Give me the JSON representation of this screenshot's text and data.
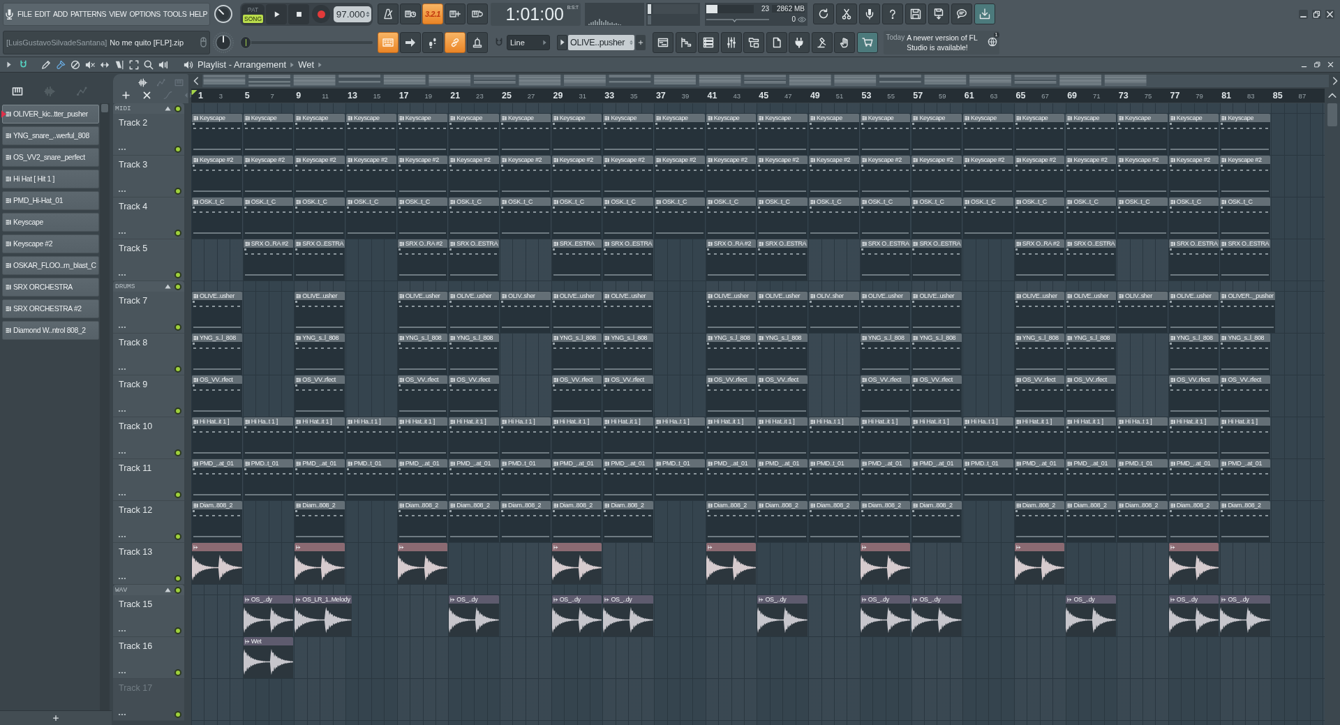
{
  "menu": [
    "FILE",
    "EDIT",
    "ADD",
    "PATTERNS",
    "VIEW",
    "OPTIONS",
    "TOOLS",
    "HELP"
  ],
  "hint": {
    "author": "[LuisGustavoSilvadeSantana]",
    "file": "No me quito [FLP].zip"
  },
  "transport": {
    "modes": [
      {
        "label": "PAT",
        "selected": false
      },
      {
        "label": "SONG",
        "selected": true
      }
    ],
    "tempo": "97.000",
    "pitch": {
      "level": 0
    }
  },
  "record_toggles": [
    {
      "on": false
    },
    {
      "on": false
    },
    {
      "label": "3.2.1",
      "on": true
    },
    {
      "on": false
    },
    {
      "on": false
    }
  ],
  "edit_toggles": [
    {
      "on": true
    },
    {
      "on": false
    },
    {
      "on": false
    },
    {
      "on": true
    },
    {
      "on": false
    }
  ],
  "time": {
    "value": "1:01:00",
    "format": "B:S:T"
  },
  "monitor": {
    "cpu": {
      "level": 0.23,
      "value": "23"
    },
    "memory": "2862 MB",
    "polyphony": "0"
  },
  "snap": {
    "value": "Line"
  },
  "pattern": {
    "name": "OLIVE..pusher"
  },
  "news": {
    "day": "Today",
    "message": "A newer version of FL Studio is available!",
    "badge": "1"
  },
  "playlist": {
    "title": "Playlist - Arrangement",
    "crumb": "Wet",
    "snap_on": true,
    "tools": [
      {
        "selected": false
      },
      {
        "selected": true
      },
      {
        "selected": false
      },
      {
        "selected": false
      },
      {
        "selected": false
      },
      {
        "selected": false
      },
      {
        "selected": false
      },
      {
        "selected": false
      },
      {
        "selected": false
      }
    ]
  },
  "picker": {
    "tabs": [
      {
        "selected": true
      },
      {
        "selected": false
      },
      {
        "selected": false
      }
    ],
    "channels": [
      {
        "name": "OLIVER_kic..tter_pusher",
        "selected": true
      },
      {
        "name": "YNG_snare_..werful_808",
        "selected": false
      },
      {
        "name": "OS_VV2_snare_perfect",
        "selected": false
      },
      {
        "name": "Hi Hat [ Hit 1 ]",
        "selected": false
      },
      {
        "name": "PMD_Hi-Hat_01",
        "selected": false
      },
      {
        "name": "Keyscape",
        "selected": false
      },
      {
        "name": "Keyscape #2",
        "selected": false
      },
      {
        "name": "OSKAR_FLOO..rn_blast_C",
        "selected": false
      },
      {
        "name": "SRX ORCHESTRA",
        "selected": false
      },
      {
        "name": "SRX ORCHESTRA #2",
        "selected": false
      },
      {
        "name": "Diamond W..ntrol 808_2",
        "selected": false
      }
    ]
  },
  "track_tools": [
    {
      "enabled": true
    },
    {
      "enabled": false
    },
    {
      "enabled": false
    },
    {
      "enabled": true
    },
    {
      "enabled": true
    },
    {
      "enabled": false
    },
    {
      "enabled": false
    }
  ],
  "ruler": [
    "1",
    "3",
    "5",
    "7",
    "9",
    "11",
    "13",
    "15",
    "17",
    "19",
    "21",
    "23",
    "25",
    "27",
    "29",
    "31",
    "33",
    "35",
    "37",
    "39",
    "41",
    "43",
    "45",
    "47",
    "49",
    "51",
    "53",
    "55",
    "57",
    "59",
    "61",
    "63",
    "65",
    "67",
    "69",
    "71",
    "73",
    "75",
    "77",
    "79",
    "81",
    "83",
    "85",
    "87"
  ],
  "tracks": [
    {
      "kind": "group",
      "name": "MIDI",
      "expanded": true,
      "enabled": true
    },
    {
      "kind": "track",
      "name": "Track 2",
      "enabled": true,
      "dimmed": false,
      "slots": [
        {
          "kind": "pattern",
          "label": "Keyscape"
        },
        {
          "kind": "pattern",
          "label": "Keyscape"
        },
        {
          "kind": "pattern",
          "label": "Keyscape"
        },
        {
          "kind": "pattern",
          "label": "Keyscape"
        },
        {
          "kind": "pattern",
          "label": "Keyscape"
        },
        {
          "kind": "pattern",
          "label": "Keyscape"
        },
        {
          "kind": "pattern",
          "label": "Keyscape"
        },
        {
          "kind": "pattern",
          "label": "Keyscape"
        },
        {
          "kind": "pattern",
          "label": "Keyscape"
        },
        {
          "kind": "pattern",
          "label": "Keyscape"
        },
        {
          "kind": "pattern",
          "label": "Keyscape"
        },
        {
          "kind": "pattern",
          "label": "Keyscape"
        },
        {
          "kind": "pattern",
          "label": "Keyscape"
        },
        {
          "kind": "pattern",
          "label": "Keyscape"
        },
        {
          "kind": "pattern",
          "label": "Keyscape"
        },
        {
          "kind": "pattern",
          "label": "Keyscape"
        },
        {
          "kind": "pattern",
          "label": "Keyscape"
        },
        {
          "kind": "pattern",
          "label": "Keyscape"
        },
        {
          "kind": "pattern",
          "label": "Keyscape"
        },
        {
          "kind": "pattern",
          "label": "Keyscape"
        },
        {
          "kind": "pattern",
          "label": "Keyscape"
        }
      ]
    },
    {
      "kind": "track",
      "name": "Track 3",
      "enabled": true,
      "dimmed": false,
      "slots": [
        {
          "kind": "pattern",
          "label": "Keyscape #2"
        },
        {
          "kind": "pattern",
          "label": "Keyscape #2"
        },
        {
          "kind": "pattern",
          "label": "Keyscape #2"
        },
        {
          "kind": "pattern",
          "label": "Keyscape #2"
        },
        {
          "kind": "pattern",
          "label": "Keyscape #2"
        },
        {
          "kind": "pattern",
          "label": "Keyscape #2"
        },
        {
          "kind": "pattern",
          "label": "Keyscape #2"
        },
        {
          "kind": "pattern",
          "label": "Keyscape #2"
        },
        {
          "kind": "pattern",
          "label": "Keyscape #2"
        },
        {
          "kind": "pattern",
          "label": "Keyscape #2"
        },
        {
          "kind": "pattern",
          "label": "Keyscape #2"
        },
        {
          "kind": "pattern",
          "label": "Keyscape #2"
        },
        {
          "kind": "pattern",
          "label": "Keyscape #2"
        },
        {
          "kind": "pattern",
          "label": "Keyscape #2"
        },
        {
          "kind": "pattern",
          "label": "Keyscape #2"
        },
        {
          "kind": "pattern",
          "label": "Keyscape #2"
        },
        {
          "kind": "pattern",
          "label": "Keyscape #2"
        },
        {
          "kind": "pattern",
          "label": "Keyscape #2"
        },
        {
          "kind": "pattern",
          "label": "Keyscape #2"
        },
        {
          "kind": "pattern",
          "label": "Keyscape #2"
        },
        {
          "kind": "pattern",
          "label": "Keyscape #2"
        }
      ]
    },
    {
      "kind": "track",
      "name": "Track 4",
      "enabled": true,
      "dimmed": false,
      "slots": [
        {
          "kind": "pattern",
          "label": "OSK..t_C"
        },
        {
          "kind": "pattern",
          "label": "OSK..t_C"
        },
        {
          "kind": "pattern",
          "label": "OSK..t_C"
        },
        {
          "kind": "pattern",
          "label": "OSK..t_C"
        },
        {
          "kind": "pattern",
          "label": "OSK..t_C"
        },
        {
          "kind": "pattern",
          "label": "OSK..t_C"
        },
        {
          "kind": "pattern",
          "label": "OSK..t_C"
        },
        {
          "kind": "pattern",
          "label": "OSK..t_C"
        },
        {
          "kind": "pattern",
          "label": "OSK..t_C"
        },
        {
          "kind": "pattern",
          "label": "OSK..t_C"
        },
        {
          "kind": "pattern",
          "label": "OSK..t_C"
        },
        {
          "kind": "pattern",
          "label": "OSK..t_C"
        },
        {
          "kind": "pattern",
          "label": "OSK..t_C"
        },
        {
          "kind": "pattern",
          "label": "OSK..t_C"
        },
        {
          "kind": "pattern",
          "label": "OSK..t_C"
        },
        {
          "kind": "pattern",
          "label": "OSK..t_C"
        },
        {
          "kind": "pattern",
          "label": "OSK..t_C"
        },
        {
          "kind": "pattern",
          "label": "OSK..t_C"
        },
        {
          "kind": "pattern",
          "label": "OSK..t_C"
        },
        {
          "kind": "pattern",
          "label": "OSK..t_C"
        },
        {
          "kind": "pattern",
          "label": "OSK..t_C"
        }
      ]
    },
    {
      "kind": "track",
      "name": "Track 5",
      "enabled": true,
      "dimmed": false,
      "slots": [
        {
          "kind": "empty"
        },
        {
          "kind": "pattern",
          "label": "SRX O..RA #2"
        },
        {
          "kind": "pattern",
          "label": "SRX O..ESTRA"
        },
        {
          "kind": "empty"
        },
        {
          "kind": "pattern",
          "label": "SRX O..RA #2"
        },
        {
          "kind": "pattern",
          "label": "SRX O..ESTRA"
        },
        {
          "kind": "empty"
        },
        {
          "kind": "pattern",
          "label": "SRX..ESTRA"
        },
        {
          "kind": "pattern",
          "label": "SRX O..ESTRA"
        },
        {
          "kind": "empty"
        },
        {
          "kind": "pattern",
          "label": "SRX O..RA #2"
        },
        {
          "kind": "pattern",
          "label": "SRX O..ESTRA"
        },
        {
          "kind": "empty"
        },
        {
          "kind": "pattern",
          "label": "SRX O..ESTRA"
        },
        {
          "kind": "pattern",
          "label": "SRX O..ESTRA"
        },
        {
          "kind": "empty"
        },
        {
          "kind": "pattern",
          "label": "SRX O..RA #2"
        },
        {
          "kind": "pattern",
          "label": "SRX O..ESTRA"
        },
        {
          "kind": "empty"
        },
        {
          "kind": "pattern",
          "label": "SRX O..ESTRA"
        },
        {
          "kind": "pattern",
          "label": "SRX O..ESTRA"
        }
      ]
    },
    {
      "kind": "group",
      "name": "DRUMS",
      "expanded": true,
      "enabled": true
    },
    {
      "kind": "track",
      "name": "Track 7",
      "enabled": true,
      "dimmed": false,
      "slots": [
        {
          "kind": "pattern",
          "label": "OLIVE..usher"
        },
        {
          "kind": "empty"
        },
        {
          "kind": "pattern",
          "label": "OLIVE..usher"
        },
        {
          "kind": "empty"
        },
        {
          "kind": "pattern",
          "label": "OLIVE..usher"
        },
        {
          "kind": "pattern",
          "label": "OLIVE..usher"
        },
        {
          "kind": "pattern",
          "label": "OLIV..sher"
        },
        {
          "kind": "pattern",
          "label": "OLIVE..usher"
        },
        {
          "kind": "pattern",
          "label": "OLIVE..usher"
        },
        {
          "kind": "empty"
        },
        {
          "kind": "pattern",
          "label": "OLIVE..usher"
        },
        {
          "kind": "pattern",
          "label": "OLIVE..usher"
        },
        {
          "kind": "pattern",
          "label": "OLIV..sher"
        },
        {
          "kind": "pattern",
          "label": "OLIVE..usher"
        },
        {
          "kind": "pattern",
          "label": "OLIVE..usher"
        },
        {
          "kind": "empty"
        },
        {
          "kind": "pattern",
          "label": "OLIVE..usher"
        },
        {
          "kind": "pattern",
          "label": "OLIVE..usher"
        },
        {
          "kind": "pattern",
          "label": "OLIV..sher"
        },
        {
          "kind": "pattern",
          "label": "OLIVE..usher"
        },
        {
          "kind": "pattern",
          "label": "OLIVER.._pusher"
        }
      ]
    },
    {
      "kind": "track",
      "name": "Track 8",
      "enabled": true,
      "dimmed": false,
      "slots": [
        {
          "kind": "pattern",
          "label": "YNG_s..l_808"
        },
        {
          "kind": "empty"
        },
        {
          "kind": "pattern",
          "label": "YNG_s..l_808"
        },
        {
          "kind": "empty"
        },
        {
          "kind": "pattern",
          "label": "YNG_s..l_808"
        },
        {
          "kind": "pattern",
          "label": "YNG_s..l_808"
        },
        {
          "kind": "empty"
        },
        {
          "kind": "pattern",
          "label": "YNG_s..l_808"
        },
        {
          "kind": "pattern",
          "label": "YNG_s..l_808"
        },
        {
          "kind": "empty"
        },
        {
          "kind": "pattern",
          "label": "YNG_s..l_808"
        },
        {
          "kind": "pattern",
          "label": "YNG_s..l_808"
        },
        {
          "kind": "empty"
        },
        {
          "kind": "pattern",
          "label": "YNG_s..l_808"
        },
        {
          "kind": "pattern",
          "label": "YNG_s..l_808"
        },
        {
          "kind": "empty"
        },
        {
          "kind": "pattern",
          "label": "YNG_s..l_808"
        },
        {
          "kind": "pattern",
          "label": "YNG_s..l_808"
        },
        {
          "kind": "empty"
        },
        {
          "kind": "pattern",
          "label": "YNG_s..l_808"
        },
        {
          "kind": "pattern",
          "label": "YNG_s..l_808"
        }
      ]
    },
    {
      "kind": "track",
      "name": "Track 9",
      "enabled": true,
      "dimmed": false,
      "slots": [
        {
          "kind": "pattern",
          "label": "OS_VV..rfect"
        },
        {
          "kind": "empty"
        },
        {
          "kind": "pattern",
          "label": "OS_VV..rfect"
        },
        {
          "kind": "empty"
        },
        {
          "kind": "pattern",
          "label": "OS_VV..rfect"
        },
        {
          "kind": "pattern",
          "label": "OS_VV..rfect"
        },
        {
          "kind": "empty"
        },
        {
          "kind": "pattern",
          "label": "OS_VV..rfect"
        },
        {
          "kind": "pattern",
          "label": "OS_VV..rfect"
        },
        {
          "kind": "empty"
        },
        {
          "kind": "pattern",
          "label": "OS_VV..rfect"
        },
        {
          "kind": "pattern",
          "label": "OS_VV..rfect"
        },
        {
          "kind": "empty"
        },
        {
          "kind": "pattern",
          "label": "OS_VV..rfect"
        },
        {
          "kind": "pattern",
          "label": "OS_VV..rfect"
        },
        {
          "kind": "empty"
        },
        {
          "kind": "pattern",
          "label": "OS_VV..rfect"
        },
        {
          "kind": "pattern",
          "label": "OS_VV..rfect"
        },
        {
          "kind": "empty"
        },
        {
          "kind": "pattern",
          "label": "OS_VV..rfect"
        },
        {
          "kind": "pattern",
          "label": "OS_VV..rfect"
        }
      ]
    },
    {
      "kind": "track",
      "name": "Track 10",
      "enabled": true,
      "dimmed": false,
      "slots": [
        {
          "kind": "pattern",
          "label": "Hi Hat..it 1 ]"
        },
        {
          "kind": "pattern",
          "label": "Hi Ha..t 1 ]"
        },
        {
          "kind": "pattern",
          "label": "Hi Hat..it 1 ]"
        },
        {
          "kind": "pattern",
          "label": "Hi Ha..t 1 ]"
        },
        {
          "kind": "pattern",
          "label": "Hi Hat..it 1 ]"
        },
        {
          "kind": "pattern",
          "label": "Hi Hat..it 1 ]"
        },
        {
          "kind": "pattern",
          "label": "Hi Ha..t 1 ]"
        },
        {
          "kind": "pattern",
          "label": "Hi Hat..it 1 ]"
        },
        {
          "kind": "pattern",
          "label": "Hi Hat..it 1 ]"
        },
        {
          "kind": "pattern",
          "label": "Hi Ha..t 1 ]"
        },
        {
          "kind": "pattern",
          "label": "Hi Hat..it 1 ]"
        },
        {
          "kind": "pattern",
          "label": "Hi Hat..it 1 ]"
        },
        {
          "kind": "pattern",
          "label": "Hi Ha..t 1 ]"
        },
        {
          "kind": "pattern",
          "label": "Hi Hat..it 1 ]"
        },
        {
          "kind": "pattern",
          "label": "Hi Hat..it 1 ]"
        },
        {
          "kind": "pattern",
          "label": "Hi Ha..t 1 ]"
        },
        {
          "kind": "pattern",
          "label": "Hi Hat..it 1 ]"
        },
        {
          "kind": "pattern",
          "label": "Hi Hat..it 1 ]"
        },
        {
          "kind": "pattern",
          "label": "Hi Ha..t 1 ]"
        },
        {
          "kind": "pattern",
          "label": "Hi Hat..it 1 ]"
        },
        {
          "kind": "pattern",
          "label": "Hi Hat..it 1 ]"
        }
      ]
    },
    {
      "kind": "track",
      "name": "Track 11",
      "enabled": true,
      "dimmed": false,
      "slots": [
        {
          "kind": "pattern",
          "label": "PMD_..at_01"
        },
        {
          "kind": "pattern",
          "label": "PMD..t_01"
        },
        {
          "kind": "pattern",
          "label": "PMD_..at_01"
        },
        {
          "kind": "pattern",
          "label": "PMD..t_01"
        },
        {
          "kind": "pattern",
          "label": "PMD_..at_01"
        },
        {
          "kind": "pattern",
          "label": "PMD_..at_01"
        },
        {
          "kind": "pattern",
          "label": "PMD..t_01"
        },
        {
          "kind": "pattern",
          "label": "PMD_..at_01"
        },
        {
          "kind": "pattern",
          "label": "PMD_..at_01"
        },
        {
          "kind": "pattern",
          "label": "PMD..t_01"
        },
        {
          "kind": "pattern",
          "label": "PMD_..at_01"
        },
        {
          "kind": "pattern",
          "label": "PMD_..at_01"
        },
        {
          "kind": "pattern",
          "label": "PMD..t_01"
        },
        {
          "kind": "pattern",
          "label": "PMD_..at_01"
        },
        {
          "kind": "pattern",
          "label": "PMD_..at_01"
        },
        {
          "kind": "pattern",
          "label": "PMD..t_01"
        },
        {
          "kind": "pattern",
          "label": "PMD_..at_01"
        },
        {
          "kind": "pattern",
          "label": "PMD_..at_01"
        },
        {
          "kind": "pattern",
          "label": "PMD..t_01"
        },
        {
          "kind": "pattern",
          "label": "PMD_..at_01"
        },
        {
          "kind": "pattern",
          "label": "PMD_..at_01"
        }
      ]
    },
    {
      "kind": "track",
      "name": "Track 12",
      "enabled": true,
      "dimmed": false,
      "slots": [
        {
          "kind": "pattern",
          "label": "Diam..808_2"
        },
        {
          "kind": "empty"
        },
        {
          "kind": "pattern",
          "label": "Diam..808_2"
        },
        {
          "kind": "empty"
        },
        {
          "kind": "pattern",
          "label": "Diam..808_2"
        },
        {
          "kind": "pattern",
          "label": "Diam..808_2"
        },
        {
          "kind": "pattern",
          "label": "Diam..808_2"
        },
        {
          "kind": "pattern",
          "label": "Diam..808_2"
        },
        {
          "kind": "pattern",
          "label": "Diam..808_2"
        },
        {
          "kind": "empty"
        },
        {
          "kind": "pattern",
          "label": "Diam..808_2"
        },
        {
          "kind": "pattern",
          "label": "Diam..808_2"
        },
        {
          "kind": "pattern",
          "label": "Diam..808_2"
        },
        {
          "kind": "pattern",
          "label": "Diam..808_2"
        },
        {
          "kind": "pattern",
          "label": "Diam..808_2"
        },
        {
          "kind": "empty"
        },
        {
          "kind": "pattern",
          "label": "Diam..808_2"
        },
        {
          "kind": "pattern",
          "label": "Diam..808_2"
        },
        {
          "kind": "pattern",
          "label": "Diam..808_2"
        },
        {
          "kind": "pattern",
          "label": "Diam..808_2"
        },
        {
          "kind": "pattern",
          "label": "Diam..808_2"
        }
      ]
    },
    {
      "kind": "track",
      "name": "Track 13",
      "enabled": true,
      "dimmed": false,
      "slots": [
        {
          "kind": "audio",
          "color": "#8b6a72"
        },
        {
          "kind": "empty"
        },
        {
          "kind": "audio",
          "color": "#8b6a72"
        },
        {
          "kind": "empty"
        },
        {
          "kind": "audio",
          "color": "#8b6a72"
        },
        {
          "kind": "empty"
        },
        {
          "kind": "empty"
        },
        {
          "kind": "audio",
          "color": "#8b6a72"
        },
        {
          "kind": "empty"
        },
        {
          "kind": "empty"
        },
        {
          "kind": "audio",
          "color": "#8b6a72"
        },
        {
          "kind": "empty"
        },
        {
          "kind": "empty"
        },
        {
          "kind": "audio",
          "color": "#8b6a72"
        },
        {
          "kind": "empty"
        },
        {
          "kind": "empty"
        },
        {
          "kind": "audio",
          "color": "#8b6a72"
        },
        {
          "kind": "empty"
        },
        {
          "kind": "empty"
        },
        {
          "kind": "audio",
          "color": "#8b6a72"
        }
      ]
    },
    {
      "kind": "group",
      "name": "WAV",
      "expanded": true,
      "enabled": true
    },
    {
      "kind": "track",
      "name": "Track 15",
      "enabled": true,
      "dimmed": false,
      "slots": [
        {
          "kind": "empty"
        },
        {
          "kind": "audio",
          "label": "OS_..dy",
          "color": "#5e5b6e"
        },
        {
          "kind": "audio",
          "label": "OS_LR_1..Melody",
          "color": "#5e5b6e"
        },
        {
          "kind": "empty"
        },
        {
          "kind": "empty"
        },
        {
          "kind": "audio",
          "label": "OS_..dy",
          "color": "#5e5b6e"
        },
        {
          "kind": "empty"
        },
        {
          "kind": "audio",
          "label": "OS_..dy",
          "color": "#5e5b6e"
        },
        {
          "kind": "audio",
          "label": "OS_..dy",
          "color": "#5e5b6e"
        },
        {
          "kind": "empty"
        },
        {
          "kind": "empty"
        },
        {
          "kind": "audio",
          "label": "OS_..dy",
          "color": "#5e5b6e"
        },
        {
          "kind": "empty"
        },
        {
          "kind": "audio",
          "label": "OS_..dy",
          "color": "#5e5b6e"
        },
        {
          "kind": "audio",
          "label": "OS_..dy",
          "color": "#5e5b6e"
        },
        {
          "kind": "empty"
        },
        {
          "kind": "empty"
        },
        {
          "kind": "audio",
          "label": "OS_..dy",
          "color": "#5e5b6e"
        },
        {
          "kind": "empty"
        },
        {
          "kind": "audio",
          "label": "OS_..dy",
          "color": "#5e5b6e"
        },
        {
          "kind": "audio",
          "label": "OS_..dy",
          "color": "#5e5b6e"
        }
      ]
    },
    {
      "kind": "track",
      "name": "Track 16",
      "enabled": true,
      "dimmed": false,
      "slots": [
        {
          "kind": "empty"
        },
        {
          "kind": "audio",
          "label": "Wet",
          "color": "#5e5b6e"
        }
      ]
    },
    {
      "kind": "track",
      "name": "Track 17",
      "enabled": true,
      "dimmed": true
    }
  ]
}
